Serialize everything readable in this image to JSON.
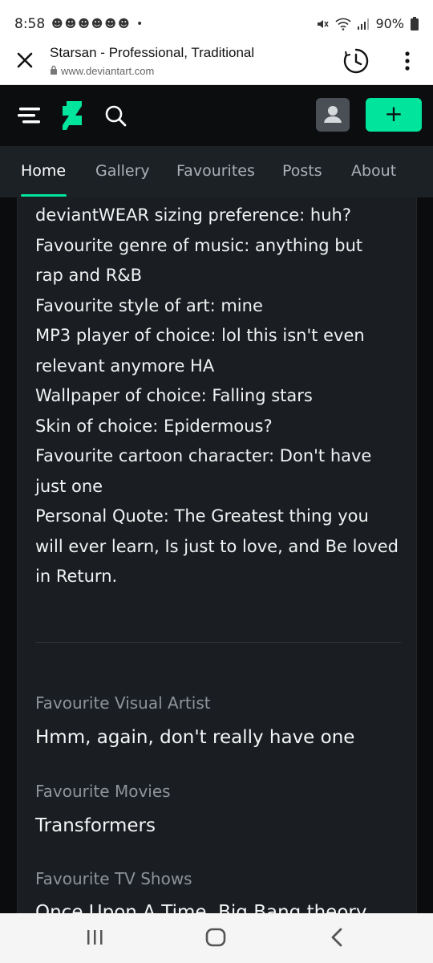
{
  "status_bar": {
    "time": "8:58",
    "notification_icons": "☻☻☻☻☻☻ •",
    "battery": "90%"
  },
  "browser": {
    "page_title": "Starsan - Professional, Traditional",
    "url": "www.deviantart.com"
  },
  "header": {
    "create_label": "+"
  },
  "tabs": [
    {
      "label": "Home",
      "active": true
    },
    {
      "label": "Gallery",
      "active": false
    },
    {
      "label": "Favourites",
      "active": false
    },
    {
      "label": "Posts",
      "active": false
    },
    {
      "label": "About",
      "active": false
    }
  ],
  "bio_lines": [
    "deviantWEAR sizing preference: huh?",
    "Favourite genre of music: anything but",
    "rap and R&B",
    "Favourite style of art: mine",
    "MP3 player of choice: lol this isn't even",
    "relevant anymore HA",
    "Wallpaper of choice: Falling stars",
    "Skin of choice: Epidermous?",
    "Favourite cartoon character: Don't have",
    "just one",
    "Personal Quote: The Greatest thing you",
    "will ever learn, Is just to love, and Be loved",
    "in Return."
  ],
  "favourites": [
    {
      "label": "Favourite Visual Artist",
      "value": "Hmm, again, don't really have one"
    },
    {
      "label": "Favourite Movies",
      "value": "Transformers"
    },
    {
      "label": "Favourite TV Shows",
      "value": "Once Upon A Time, Big Bang theory"
    }
  ],
  "colors": {
    "accent": "#00e59b",
    "header_bg": "#0b0d0f",
    "tab_bg": "#1c2126",
    "panel_bg": "#1a1d21"
  }
}
